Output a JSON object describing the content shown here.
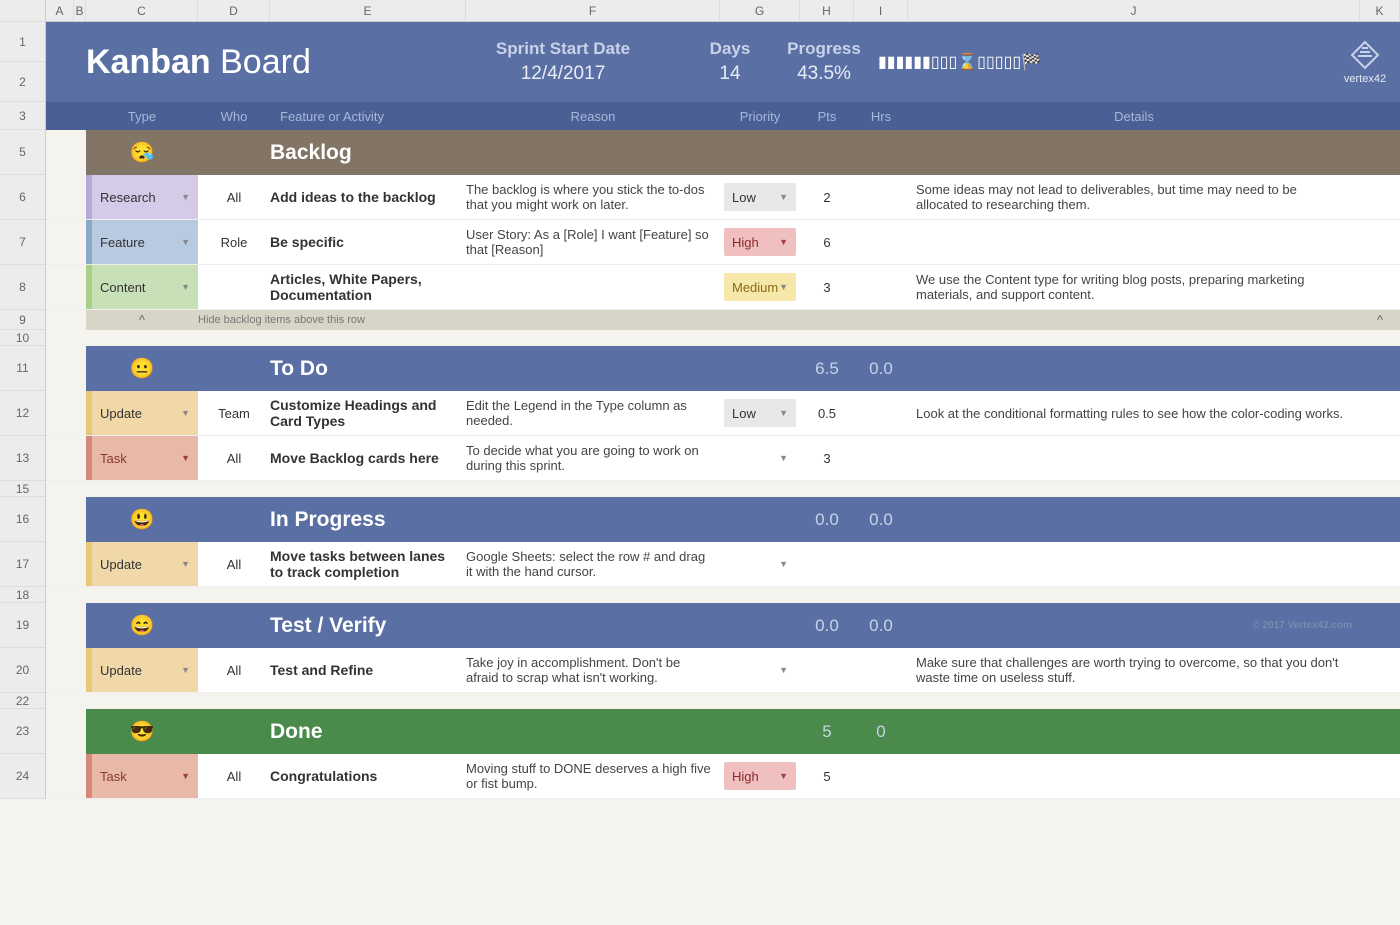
{
  "columns": [
    "A",
    "B",
    "C",
    "D",
    "E",
    "F",
    "G",
    "H",
    "I",
    "J",
    "K"
  ],
  "rows": [
    "1",
    "2",
    "3",
    "5",
    "6",
    "7",
    "8",
    "9",
    "10",
    "11",
    "12",
    "13",
    "15",
    "16",
    "17",
    "18",
    "19",
    "20",
    "22",
    "23",
    "24"
  ],
  "title": {
    "bold": "Kanban",
    "rest": " Board"
  },
  "sprint": {
    "label": "Sprint Start Date",
    "value": "12/4/2017"
  },
  "days": {
    "label": "Days",
    "value": "14"
  },
  "progress": {
    "label": "Progress",
    "value": "43.5%"
  },
  "progress_icons": "▮▮▮▮▮▮▯▯▯⌛▯▯▯▯▯🏁",
  "brand": "vertex42",
  "headers": {
    "type": "Type",
    "who": "Who",
    "feature": "Feature or Activity",
    "reason": "Reason",
    "priority": "Priority",
    "pts": "Pts",
    "hrs": "Hrs",
    "details": "Details"
  },
  "hide_text": "Hide backlog items above this row",
  "hide_caret": "^",
  "copyright": "© 2017 Vertex42.com",
  "lanes": {
    "backlog": {
      "emoji": "😪",
      "title": "Backlog",
      "pts": "",
      "hrs": "",
      "items": [
        {
          "type": "Research",
          "type_class": "type-research",
          "who": "All",
          "feature": "Add ideas to the backlog",
          "reason": "The backlog is where you stick the to-dos that you might work on later.",
          "priority": "Low",
          "prio_class": "prio-low",
          "pts": "2",
          "details": "Some ideas may not lead to deliverables, but time may need to be allocated to researching them."
        },
        {
          "type": "Feature",
          "type_class": "type-feature",
          "who": "Role",
          "feature": "Be specific",
          "reason": "User Story: As a [Role] I want [Feature] so that [Reason]",
          "priority": "High",
          "prio_class": "prio-high",
          "pts": "6",
          "details": ""
        },
        {
          "type": "Content",
          "type_class": "type-content",
          "who": "",
          "feature": "Articles, White Papers, Documentation",
          "reason": "",
          "priority": "Medium",
          "prio_class": "prio-med",
          "pts": "3",
          "details": "We use the Content type for writing blog posts, preparing marketing materials, and support content."
        }
      ]
    },
    "todo": {
      "emoji": "😐",
      "title": "To Do",
      "pts": "6.5",
      "hrs": "0.0",
      "items": [
        {
          "type": "Update",
          "type_class": "type-update",
          "who": "Team",
          "feature": "Customize Headings and Card Types",
          "reason": "Edit the Legend in the Type column as needed.",
          "priority": "Low",
          "prio_class": "prio-low",
          "pts": "0.5",
          "details": "Look at the conditional formatting rules to see how the color-coding works."
        },
        {
          "type": "Task",
          "type_class": "type-task",
          "who": "All",
          "feature": "Move Backlog cards here",
          "reason": "To decide what you are going to work on during this sprint.",
          "priority": "",
          "prio_class": "prio-none",
          "pts": "3",
          "details": ""
        }
      ]
    },
    "inprogress": {
      "emoji": "😃",
      "title": "In Progress",
      "pts": "0.0",
      "hrs": "0.0",
      "items": [
        {
          "type": "Update",
          "type_class": "type-update",
          "who": "All",
          "feature": "Move tasks between lanes to track completion",
          "reason": "Google Sheets: select the row # and drag it with the hand cursor.",
          "priority": "",
          "prio_class": "prio-none",
          "pts": "",
          "details": ""
        }
      ]
    },
    "test": {
      "emoji": "😄",
      "title": "Test / Verify",
      "pts": "0.0",
      "hrs": "0.0",
      "items": [
        {
          "type": "Update",
          "type_class": "type-update",
          "who": "All",
          "feature": "Test and Refine",
          "reason": "Take joy in accomplishment. Don't be afraid to scrap what isn't working.",
          "priority": "",
          "prio_class": "prio-none",
          "pts": "",
          "details": "Make sure that challenges are worth trying to overcome, so that you don't waste time on useless stuff."
        }
      ]
    },
    "done": {
      "emoji": "😎",
      "title": "Done",
      "pts": "5",
      "hrs": "0",
      "items": [
        {
          "type": "Task",
          "type_class": "type-task",
          "who": "All",
          "feature": "Congratulations",
          "reason": "Moving stuff to DONE deserves a high five or fist bump.",
          "priority": "High",
          "prio_class": "prio-high",
          "pts": "5",
          "details": ""
        }
      ]
    }
  }
}
